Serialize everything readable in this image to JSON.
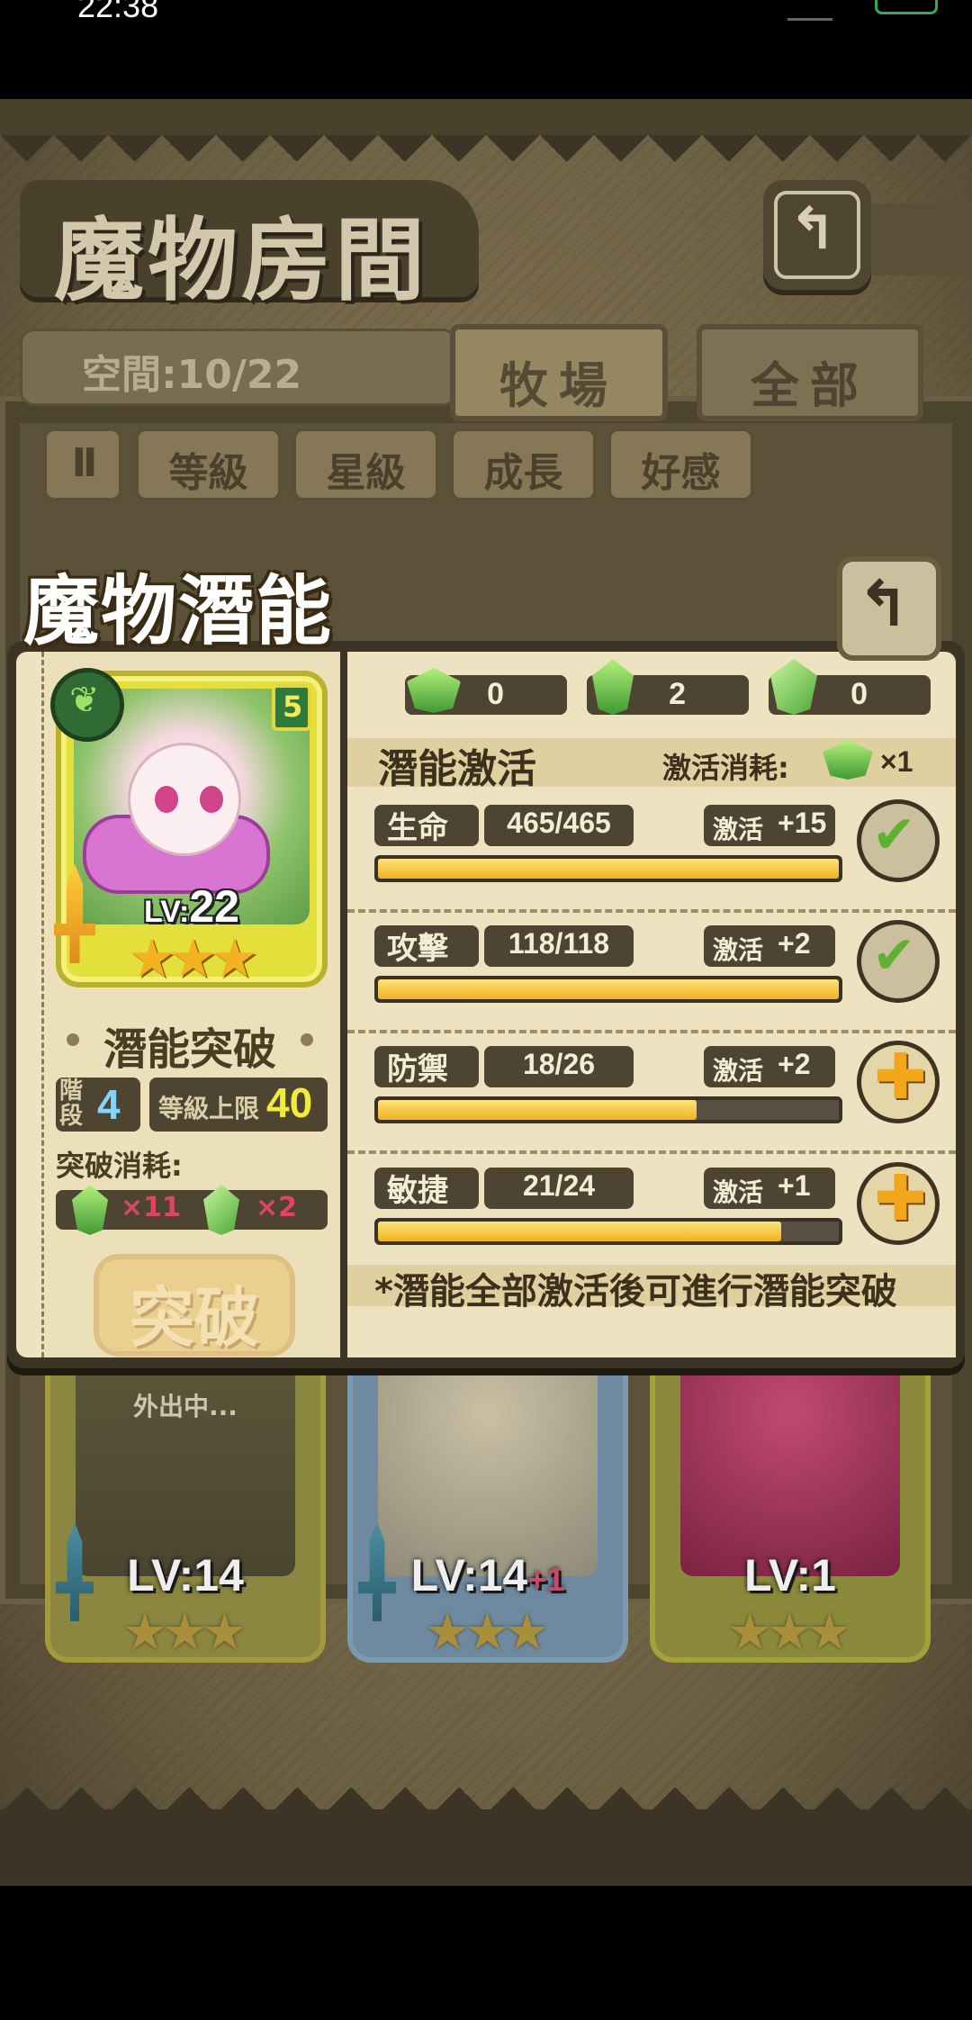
{
  "status": {
    "time": "22:38"
  },
  "room": {
    "title": "魔物房間",
    "back_icon": "↰",
    "space": "空間:10/22",
    "tabs": [
      "牧場",
      "全部"
    ],
    "sort_buttons": [
      "II",
      "等級",
      "星級",
      "成長",
      "好感"
    ]
  },
  "bg_cards": [
    {
      "level": "LV:14",
      "status": "外出中...",
      "stars": "★★★"
    },
    {
      "level": "LV:14",
      "bonus": "+1",
      "stars": "★★★"
    },
    {
      "level": "LV:1",
      "stars": "★★★"
    }
  ],
  "popup": {
    "title": "魔物潛能",
    "back_icon": "↰",
    "monster": {
      "level_prefix": "LV:",
      "level": "22",
      "rank": "5",
      "stars": "★★★"
    },
    "breakthrough": {
      "title": "潛能突破",
      "stage_label": "階段",
      "stage": "4",
      "cap_label": "等級上限",
      "cap": "40",
      "cost_label": "突破消耗:",
      "cost": [
        "×11",
        "×2"
      ],
      "button": "突破"
    },
    "resources": [
      "0",
      "2",
      "0"
    ],
    "activation": {
      "title": "潛能激活",
      "cost_label": "激活消耗:",
      "cost_qty": "×1"
    },
    "stats": [
      {
        "name": "生命",
        "value": "465/465",
        "bonus_label": "激活",
        "bonus": "+15",
        "progress": 1.0,
        "done": true,
        "icon": "✔"
      },
      {
        "name": "攻擊",
        "value": "118/118",
        "bonus_label": "激活",
        "bonus": "+2",
        "progress": 1.0,
        "done": true,
        "icon": "✔"
      },
      {
        "name": "防禦",
        "value": "18/26",
        "bonus_label": "激活",
        "bonus": "+2",
        "progress": 0.6923,
        "done": false,
        "icon": "✚"
      },
      {
        "name": "敏捷",
        "value": "21/24",
        "bonus_label": "激活",
        "bonus": "+1",
        "progress": 0.875,
        "done": false,
        "icon": "✚"
      }
    ],
    "note": "*潛能全部激活後可進行潛能突破"
  }
}
